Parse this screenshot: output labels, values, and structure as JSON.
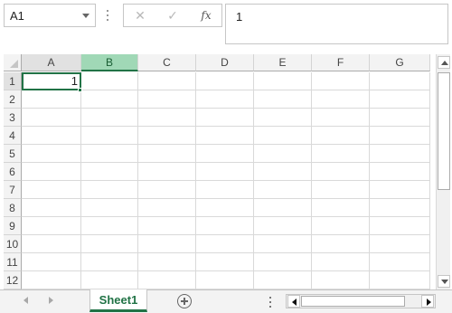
{
  "name_box": {
    "value": "A1"
  },
  "formula_bar": {
    "cancel_icon": "✕",
    "confirm_icon": "✓",
    "fx_label": "fx",
    "value": "1"
  },
  "columns": [
    "A",
    "B",
    "C",
    "D",
    "E",
    "F",
    "G"
  ],
  "rows": [
    "1",
    "2",
    "3",
    "4",
    "5",
    "6",
    "7",
    "8",
    "9",
    "10",
    "11",
    "12"
  ],
  "cells": {
    "A1": "1"
  },
  "sheet_tabs": [
    {
      "label": "Sheet1",
      "active": true
    }
  ],
  "colors": {
    "accent": "#217346",
    "selected_column_header": "#a0d8b6"
  },
  "icons": {
    "namebox_dropdown": "chevron-down-icon",
    "add_sheet": "plus-circle-icon",
    "scroll_prev": "triangle-left-icon",
    "scroll_next": "triangle-right-icon"
  }
}
